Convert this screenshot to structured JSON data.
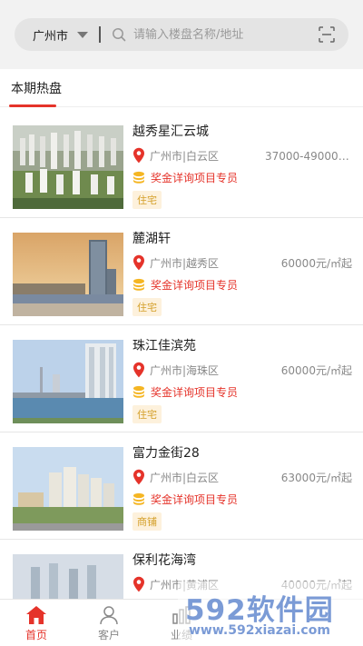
{
  "header": {
    "city": "广州市",
    "search_placeholder": "请输入楼盘名称/地址"
  },
  "section": {
    "title": "本期热盘"
  },
  "properties": [
    {
      "name": "越秀星汇云城",
      "location": "广州市|白云区",
      "price": "37000-49000元...",
      "bonus": "奖金详询项目专员",
      "tag": "住宅"
    },
    {
      "name": "麓湖轩",
      "location": "广州市|越秀区",
      "price": "60000元/㎡起",
      "bonus": "奖金详询项目专员",
      "tag": "住宅"
    },
    {
      "name": "珠江佳滨苑",
      "location": "广州市|海珠区",
      "price": "60000元/㎡起",
      "bonus": "奖金详询项目专员",
      "tag": "住宅"
    },
    {
      "name": "富力金街28",
      "location": "广州市|白云区",
      "price": "63000元/㎡起",
      "bonus": "奖金详询项目专员",
      "tag": "商铺"
    },
    {
      "name": "保利花海湾",
      "location": "广州市|黄浦区",
      "price": "40000元/㎡起",
      "bonus": "",
      "tag": ""
    }
  ],
  "tabbar": {
    "tabs": [
      {
        "label": "首页",
        "icon": "home-icon",
        "active": true
      },
      {
        "label": "客户",
        "icon": "customer-icon",
        "active": false
      },
      {
        "label": "业绩",
        "icon": "performance-icon",
        "active": false
      }
    ]
  },
  "watermark": {
    "main": "592软件园",
    "url": "www.592xiazai.com"
  },
  "colors": {
    "accent": "#e5332a",
    "tag_bg": "#fdf1dc",
    "tag_text": "#d4a02a",
    "coin": "#f5b623"
  }
}
